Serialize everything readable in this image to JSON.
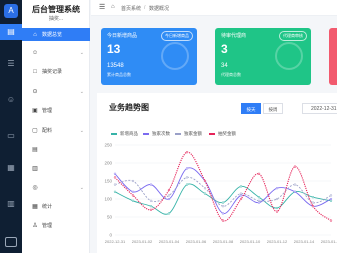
{
  "app": {
    "title": "后台管理系统",
    "user_line": "抽奖..."
  },
  "rail": {
    "logo": "A",
    "icons": [
      "doc-icon",
      "list-icon",
      "user-icon",
      "ticket-icon",
      "grid-icon",
      "chart-icon"
    ]
  },
  "sidebar": {
    "items": [
      {
        "label": "数据总览",
        "icon": "home-icon",
        "active": true
      },
      {
        "label": "",
        "icon": "user-icon",
        "active": false
      },
      {
        "label": "抽奖记录",
        "icon": "gift-icon",
        "active": false
      },
      {
        "label": "",
        "icon": "ticket-icon",
        "active": false
      },
      {
        "label": "管理",
        "icon": "box-icon",
        "active": false
      },
      {
        "label": "配料",
        "icon": "box-icon",
        "active": false
      },
      {
        "label": "",
        "icon": "lock-icon",
        "active": false
      },
      {
        "label": "",
        "icon": "file-icon",
        "active": false
      },
      {
        "label": "",
        "icon": "coin-icon",
        "active": false
      },
      {
        "label": "统计",
        "icon": "stats-icon",
        "active": false
      },
      {
        "label": "管理",
        "icon": "person-icon",
        "active": false
      }
    ]
  },
  "topbar": {
    "crumb_1": "首页系统",
    "crumb_2": "数据概况"
  },
  "cards": [
    {
      "title": "今日新增商品",
      "badge": "今日新增商品",
      "big": "13",
      "num": "13548",
      "cap": "累计商品总数",
      "color": "#2f8cf5"
    },
    {
      "title": "待审代理商",
      "badge": "代理商审核",
      "big": "3",
      "num": "34",
      "cap": "代理商总数",
      "color": "#1fc587"
    },
    {
      "title": "",
      "badge": "",
      "big": "",
      "num": "",
      "cap": "",
      "color": "#f25a6e"
    }
  ],
  "chart_panel": {
    "title": "业务趋势图",
    "btn_active": "按天",
    "btn_other": "按周",
    "date": "2022-12-31"
  },
  "chart_data": {
    "type": "line",
    "categories": [
      "2022-12-31",
      "2023-01-02",
      "2023-01-04",
      "2023-01-06",
      "2023-01-08",
      "2023-01-10",
      "2023-01-12",
      "2023-01-14",
      "2023-01-16"
    ],
    "ylim": [
      0,
      250
    ],
    "yticks": [
      0,
      50,
      100,
      150,
      200,
      250
    ],
    "legend_position": "top",
    "series": [
      {
        "name": "新增商品",
        "color": "#36b3a8",
        "dash": "",
        "values": [
          120,
          95,
          80,
          60,
          140,
          115,
          90,
          135,
          105,
          75,
          120,
          105,
          95
        ]
      },
      {
        "name": "独家次数",
        "color": "#7b6bf0",
        "dash": "",
        "values": [
          170,
          120,
          140,
          100,
          185,
          150,
          60,
          110,
          90,
          130,
          120,
          80,
          100
        ]
      },
      {
        "name": "独家金额",
        "color": "#9aa0c8",
        "dash": "2 1.5",
        "values": [
          140,
          150,
          95,
          110,
          160,
          130,
          80,
          115,
          95,
          100,
          140,
          90,
          110
        ]
      },
      {
        "name": "抽奖金额",
        "color": "#e6245a",
        "dash": "1.2 1",
        "values": [
          160,
          110,
          70,
          125,
          230,
          150,
          40,
          100,
          170,
          65,
          190,
          80,
          40
        ]
      }
    ]
  }
}
